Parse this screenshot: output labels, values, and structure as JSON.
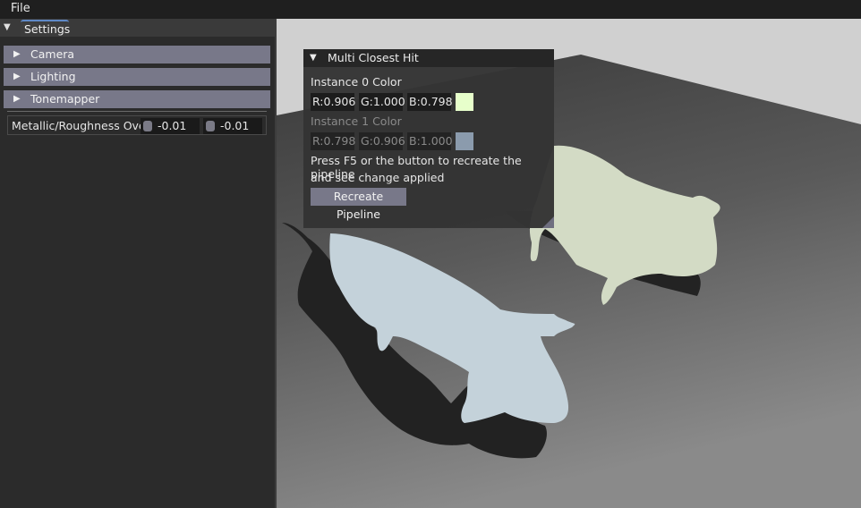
{
  "menu": {
    "file_label": "File"
  },
  "settings": {
    "tab_label": "Settings",
    "sections": [
      {
        "label": "Camera"
      },
      {
        "label": "Lighting"
      },
      {
        "label": "Tonemapper"
      }
    ],
    "override": {
      "label": "Metallic/Roughness Ove",
      "metallic_value": "-0.01",
      "roughness_value": "-0.01"
    }
  },
  "window": {
    "title": "Multi Closest Hit",
    "instance0": {
      "label": "Instance 0 Color",
      "r": "R:0.906",
      "g": "G:1.000",
      "b": "B:0.798",
      "color": "#e7ffcb"
    },
    "instance1": {
      "label": "Instance 1 Color",
      "r": "R:0.798",
      "g": "G:0.906",
      "b": "B:1.000",
      "color": "#8b9bad"
    },
    "help_line1": "Press F5 or the button to recreate the pipeline",
    "help_line2": "and see change applied",
    "button_label": "Recreate Pipeline"
  },
  "scene": {
    "background_color": "#d0d0d0",
    "floor_color": "#6a6a6a",
    "shadow_color": "#222222",
    "instance0_render_color": "#d3dbc5",
    "instance1_render_color": "#c4d2da"
  }
}
